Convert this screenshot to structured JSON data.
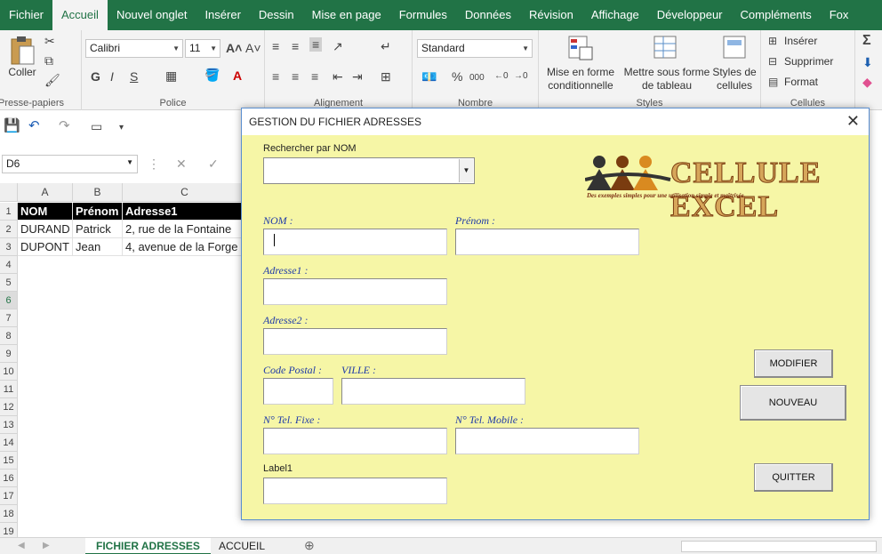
{
  "ribbon_tabs": [
    "Fichier",
    "Accueil",
    "Nouvel onglet",
    "Insérer",
    "Dessin",
    "Mise en page",
    "Formules",
    "Données",
    "Révision",
    "Affichage",
    "Développeur",
    "Compléments",
    "Fox"
  ],
  "ribbon": {
    "paste_label": "Coller",
    "clipboard_group": "Presse-papiers",
    "font_name": "Calibri",
    "font_size": "11",
    "bold": "G",
    "italic": "I",
    "underline": "S",
    "font_group": "Police",
    "align_group": "Alignement",
    "number_format": "Standard",
    "percent": "%",
    "thousands": "000",
    "number_group": "Nombre",
    "cond_format_l1": "Mise en forme",
    "cond_format_l2": "conditionnelle",
    "table_format_l1": "Mettre sous forme",
    "table_format_l2": "de tableau",
    "cell_styles_l1": "Styles de",
    "cell_styles_l2": "cellules",
    "styles_group": "Styles",
    "insert_label": "Insérer",
    "delete_label": "Supprimer",
    "format_label": "Format",
    "cells_group": "Cellules"
  },
  "formula_bar": {
    "name_box": "D6"
  },
  "columns": [
    "A",
    "B",
    "C"
  ],
  "rows": [
    "1",
    "2",
    "3",
    "4",
    "5",
    "6",
    "7",
    "8",
    "9",
    "10",
    "11",
    "12",
    "13",
    "14",
    "15",
    "16",
    "17",
    "18",
    "19"
  ],
  "cells": [
    [
      "NOM",
      "Prénom",
      "Adresse1"
    ],
    [
      "DURAND",
      "Patrick",
      "2, rue de la Fontaine"
    ],
    [
      "DUPONT",
      "Jean",
      "4, avenue de la Forge"
    ]
  ],
  "sheet_tabs": {
    "active": "FICHIER ADRESSES",
    "other": "ACCUEIL"
  },
  "dialog": {
    "title": "GESTION DU FICHIER ADRESSES",
    "search_label": "Rechercher par NOM",
    "nom_label": "NOM :",
    "prenom_label": "Prénom :",
    "adresse1_label": "Adresse1 :",
    "adresse2_label": "Adresse2 :",
    "cp_label": "Code Postal :",
    "ville_label": "VILLE :",
    "tel_fixe_label": "N° Tel. Fixe :",
    "tel_mobile_label": "N° Tel. Mobile :",
    "label1": "Label1",
    "btn_modifier": "MODIFIER",
    "btn_nouveau": "NOUVEAU",
    "btn_quitter": "QUITTER",
    "logo_text": "CELLULE EXCEL",
    "logo_sub": "Des exemples simples pour une utilisation simple et maîtrisée."
  }
}
